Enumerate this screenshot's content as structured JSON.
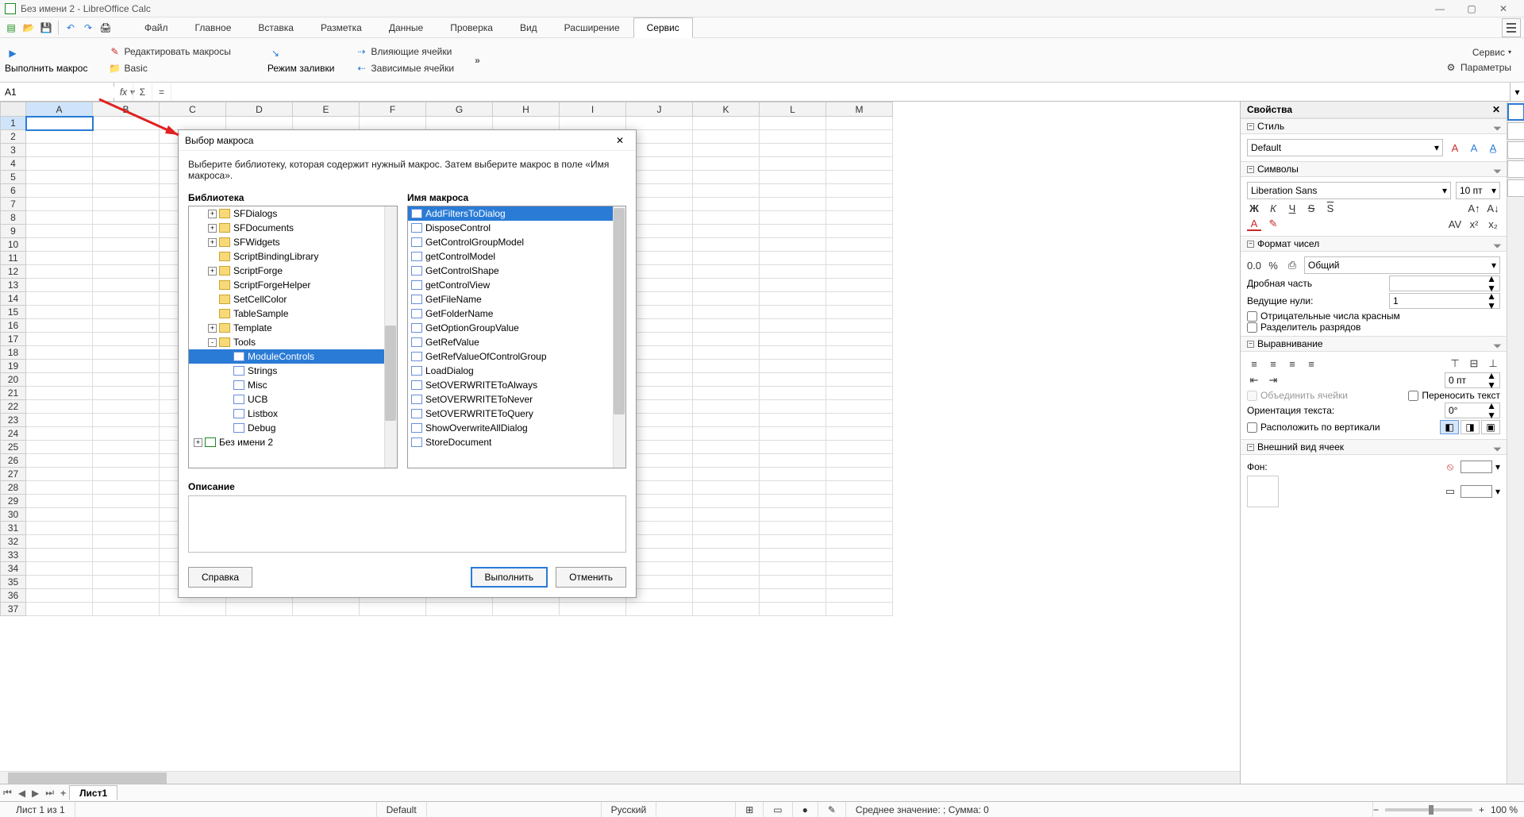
{
  "window": {
    "title": "Без имени 2 - LibreOffice Calc"
  },
  "menu": {
    "items": [
      "Файл",
      "Главное",
      "Вставка",
      "Разметка",
      "Данные",
      "Проверка",
      "Вид",
      "Расширение",
      "Сервис"
    ],
    "active": 8
  },
  "ribbon": {
    "run_macro": "Выполнить макрос",
    "basic": "Basic",
    "edit_macros": "Редактировать макросы",
    "fill_mode": "Режим заливки",
    "influencing": "Влияющие ячейки",
    "dependent": "Зависимые ячейки",
    "service": "Сервис",
    "params": "Параметры"
  },
  "formula": {
    "cellref": "A1",
    "value": ""
  },
  "columns": [
    "A",
    "B",
    "C",
    "D",
    "E",
    "F",
    "G",
    "H",
    "I",
    "J",
    "K",
    "L",
    "M"
  ],
  "rows": 37,
  "active_cell": {
    "row": 1,
    "col": 0
  },
  "sidebar": {
    "title": "Свойства",
    "style": {
      "label": "Стиль",
      "value": "Default"
    },
    "symbols": {
      "label": "Символы",
      "font": "Liberation Sans",
      "size": "10 пт",
      "bold": "Ж",
      "italic": "К",
      "underline": "Ч",
      "strike": "S",
      "overline": "S"
    },
    "numfmt": {
      "label": "Формат чисел",
      "format": "Общий",
      "decimals_label": "Дробная часть",
      "decimals": "",
      "leading_label": "Ведущие нули:",
      "leading": "1",
      "neg_red": "Отрицательные числа красным",
      "thousands": "Разделитель разрядов"
    },
    "align": {
      "label": "Выравнивание",
      "indent": "0 пт",
      "merge": "Объединить ячейки",
      "wrap": "Переносить текст",
      "orient_label": "Ориентация текста:",
      "orient": "0°",
      "vertical": "Расположить по вертикали"
    },
    "cells": {
      "label": "Внешний вид ячеек",
      "bg_label": "Фон:"
    }
  },
  "dialog": {
    "title": "Выбор макроса",
    "desc": "Выберите библиотеку, которая содержит нужный макрос. Затем выберите макрос в поле «Имя макроса».",
    "lib_label": "Библиотека",
    "macro_label": "Имя макроса",
    "desc_label": "Описание",
    "help": "Справка",
    "run": "Выполнить",
    "cancel": "Отменить",
    "tree": [
      {
        "ind": 1,
        "exp": "+",
        "t": "folder",
        "label": "SFDialogs"
      },
      {
        "ind": 1,
        "exp": "+",
        "t": "folder",
        "label": "SFDocuments"
      },
      {
        "ind": 1,
        "exp": "+",
        "t": "folder",
        "label": "SFWidgets"
      },
      {
        "ind": 1,
        "exp": "",
        "t": "folder",
        "label": "ScriptBindingLibrary"
      },
      {
        "ind": 1,
        "exp": "+",
        "t": "folder",
        "label": "ScriptForge"
      },
      {
        "ind": 1,
        "exp": "",
        "t": "folder",
        "label": "ScriptForgeHelper"
      },
      {
        "ind": 1,
        "exp": "",
        "t": "folder",
        "label": "SetCellColor"
      },
      {
        "ind": 1,
        "exp": "",
        "t": "folder",
        "label": "TableSample"
      },
      {
        "ind": 1,
        "exp": "+",
        "t": "folder",
        "label": "Template"
      },
      {
        "ind": 1,
        "exp": "-",
        "t": "folder",
        "label": "Tools"
      },
      {
        "ind": 2,
        "exp": "",
        "t": "module",
        "label": "ModuleControls",
        "sel": true
      },
      {
        "ind": 2,
        "exp": "",
        "t": "module",
        "label": "Strings"
      },
      {
        "ind": 2,
        "exp": "",
        "t": "module",
        "label": "Misc"
      },
      {
        "ind": 2,
        "exp": "",
        "t": "module",
        "label": "UCB"
      },
      {
        "ind": 2,
        "exp": "",
        "t": "module",
        "label": "Listbox"
      },
      {
        "ind": 2,
        "exp": "",
        "t": "module",
        "label": "Debug"
      },
      {
        "ind": 0,
        "exp": "+",
        "t": "doc",
        "label": "Без имени 2"
      }
    ],
    "macros": [
      {
        "label": "AddFiltersToDialog",
        "sel": true
      },
      {
        "label": "DisposeControl"
      },
      {
        "label": "GetControlGroupModel"
      },
      {
        "label": "getControlModel"
      },
      {
        "label": "GetControlShape"
      },
      {
        "label": "getControlView"
      },
      {
        "label": "GetFileName"
      },
      {
        "label": "GetFolderName"
      },
      {
        "label": "GetOptionGroupValue"
      },
      {
        "label": "GetRefValue"
      },
      {
        "label": "GetRefValueOfControlGroup"
      },
      {
        "label": "LoadDialog"
      },
      {
        "label": "SetOVERWRITEToAlways"
      },
      {
        "label": "SetOVERWRITEToNever"
      },
      {
        "label": "SetOVERWRITEToQuery"
      },
      {
        "label": "ShowOverwriteAllDialog"
      },
      {
        "label": "StoreDocument"
      }
    ]
  },
  "sheettab": "Лист1",
  "status": {
    "sheet": "Лист 1 из 1",
    "style": "Default",
    "lang": "Русский",
    "stats": "Среднее значение: ; Сумма: 0",
    "zoom": "100 %"
  }
}
